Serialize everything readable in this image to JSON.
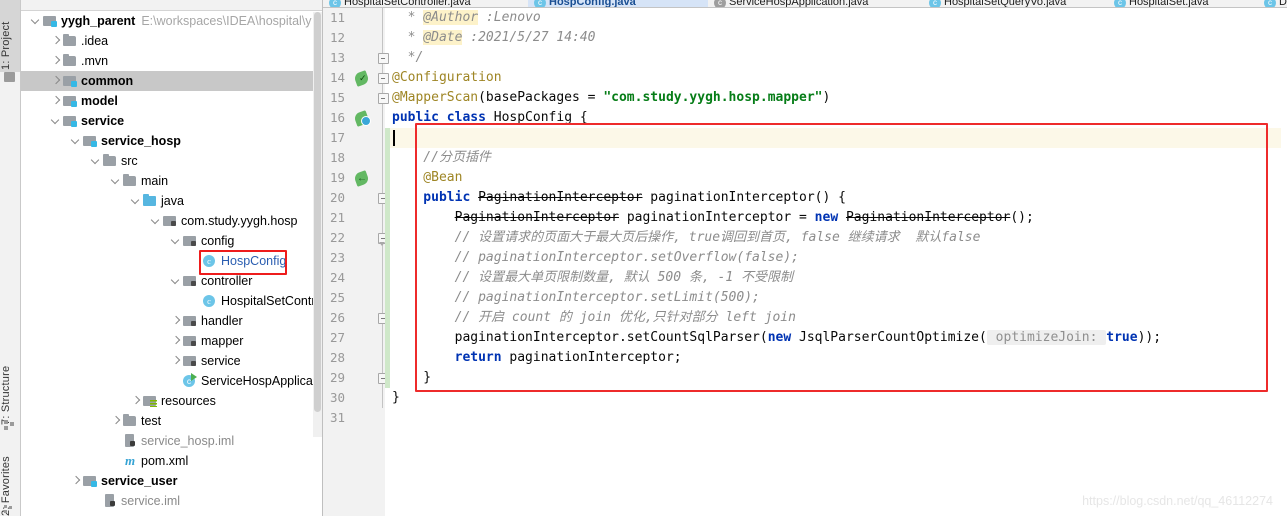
{
  "toolwindows": {
    "project": "1: Project",
    "structure": "7: Structure",
    "favorites": "2: Favorites"
  },
  "project_tree": {
    "root": {
      "label": "yygh_parent",
      "path": "E:\\workspaces\\IDEA\\hospital\\y"
    },
    "items": [
      {
        "label": "yygh_parent",
        "path": "E:\\workspaces\\IDEA\\hospital\\y",
        "icon": "module-folder-icon",
        "indent": 0,
        "arrow": "down",
        "bold": true,
        "selected": false
      },
      {
        "label": ".idea",
        "icon": "folder-icon",
        "indent": 1,
        "arrow": "right",
        "bold": false,
        "selected": false
      },
      {
        "label": ".mvn",
        "icon": "folder-icon",
        "indent": 1,
        "arrow": "right",
        "bold": false,
        "selected": false
      },
      {
        "label": "common",
        "icon": "module-folder-icon",
        "indent": 1,
        "arrow": "right",
        "bold": true,
        "selected": true
      },
      {
        "label": "model",
        "icon": "module-folder-icon",
        "indent": 1,
        "arrow": "right",
        "bold": true,
        "selected": false
      },
      {
        "label": "service",
        "icon": "module-folder-icon",
        "indent": 1,
        "arrow": "down",
        "bold": true,
        "selected": false
      },
      {
        "label": "service_hosp",
        "icon": "module-folder-icon",
        "indent": 2,
        "arrow": "down",
        "bold": true,
        "selected": false
      },
      {
        "label": "src",
        "icon": "folder-icon",
        "indent": 3,
        "arrow": "down",
        "bold": false,
        "selected": false
      },
      {
        "label": "main",
        "icon": "folder-icon",
        "indent": 4,
        "arrow": "down",
        "bold": false,
        "selected": false
      },
      {
        "label": "java",
        "icon": "source-folder-icon",
        "indent": 5,
        "arrow": "down",
        "bold": false,
        "selected": false
      },
      {
        "label": "com.study.yygh.hosp",
        "icon": "package-icon",
        "indent": 6,
        "arrow": "down",
        "bold": false,
        "selected": false
      },
      {
        "label": "config",
        "icon": "package-icon",
        "indent": 7,
        "arrow": "down",
        "bold": false,
        "selected": false
      },
      {
        "label": "HospConfig",
        "icon": "java-class-icon",
        "indent": 8,
        "arrow": "none",
        "bold": false,
        "selected": false,
        "blue": true,
        "highlight": true
      },
      {
        "label": "controller",
        "icon": "package-icon",
        "indent": 7,
        "arrow": "down",
        "bold": false,
        "selected": false
      },
      {
        "label": "HospitalSetContr",
        "icon": "java-class-icon",
        "indent": 8,
        "arrow": "none",
        "bold": false,
        "selected": false
      },
      {
        "label": "handler",
        "icon": "package-icon",
        "indent": 7,
        "arrow": "right",
        "bold": false,
        "selected": false
      },
      {
        "label": "mapper",
        "icon": "package-icon",
        "indent": 7,
        "arrow": "right",
        "bold": false,
        "selected": false
      },
      {
        "label": "service",
        "icon": "package-icon",
        "indent": 7,
        "arrow": "right",
        "bold": false,
        "selected": false
      },
      {
        "label": "ServiceHospApplicat",
        "icon": "spring-boot-class-icon",
        "indent": 7,
        "arrow": "none",
        "bold": false,
        "selected": false
      },
      {
        "label": "resources",
        "icon": "resources-folder-icon",
        "indent": 5,
        "arrow": "right",
        "bold": false,
        "selected": false
      },
      {
        "label": "test",
        "icon": "folder-icon",
        "indent": 4,
        "arrow": "right",
        "bold": false,
        "selected": false
      },
      {
        "label": "service_hosp.iml",
        "icon": "iml-file-icon",
        "indent": 4,
        "arrow": "none",
        "bold": false,
        "selected": false,
        "grey": true
      },
      {
        "label": "pom.xml",
        "icon": "maven-pom-icon",
        "indent": 4,
        "arrow": "none",
        "bold": false,
        "selected": false
      },
      {
        "label": "service_user",
        "icon": "module-folder-icon",
        "indent": 2,
        "arrow": "right",
        "bold": true,
        "selected": false
      },
      {
        "label": "service.iml",
        "icon": "iml-file-icon",
        "indent": 3,
        "arrow": "none",
        "bold": false,
        "selected": false,
        "grey": true
      }
    ]
  },
  "editor_tabs": [
    {
      "label": "HospitalSetController.java",
      "icon": "java-class-icon",
      "active": false
    },
    {
      "label": "HospConfig.java",
      "icon": "java-class-icon",
      "active": true
    },
    {
      "label": "ServiceHospApplication.java",
      "icon": "spring-boot-class-icon",
      "active": false
    },
    {
      "label": "HospitalSetQueryVo.java",
      "icon": "java-class-icon",
      "active": false
    },
    {
      "label": "HospitalSet.java",
      "icon": "java-class-icon",
      "active": false
    },
    {
      "label": "DataSou",
      "icon": "java-class-icon",
      "active": false
    }
  ],
  "editor": {
    "first_line": 11,
    "caret_line": 17,
    "lines": [
      {
        "n": 11,
        "gutter_icon": "none",
        "fold": "none",
        "tokens": [
          {
            "t": "  * ",
            "c": "cmt"
          },
          {
            "t": "@Author",
            "c": "cmt hl"
          },
          {
            "t": " :Lenovo",
            "c": "cmt"
          }
        ]
      },
      {
        "n": 12,
        "gutter_icon": "none",
        "fold": "none",
        "tokens": [
          {
            "t": "  * ",
            "c": "cmt"
          },
          {
            "t": "@Date",
            "c": "cmt hl"
          },
          {
            "t": " :2021/5/27 14:40",
            "c": "cmt"
          }
        ]
      },
      {
        "n": 13,
        "gutter_icon": "none",
        "fold": "end",
        "tokens": [
          {
            "t": "  */",
            "c": "cmt"
          }
        ]
      },
      {
        "n": 14,
        "gutter_icon": "bean-leaf-check-icon",
        "fold": "start",
        "tokens": [
          {
            "t": "@Configuration",
            "c": "ann"
          }
        ]
      },
      {
        "n": 15,
        "gutter_icon": "none",
        "fold": "start",
        "tokens": [
          {
            "t": "@MapperScan",
            "c": "ann"
          },
          {
            "t": "(basePackages = ",
            "c": "plain"
          },
          {
            "t": "\"com.study.yygh.hosp.mapper\"",
            "c": "str"
          },
          {
            "t": ")",
            "c": "plain"
          }
        ]
      },
      {
        "n": 16,
        "gutter_icon": "bean-blue-icon",
        "fold": "none",
        "tokens": [
          {
            "t": "public class ",
            "c": "kw"
          },
          {
            "t": "HospConfig {",
            "c": "plain"
          }
        ]
      },
      {
        "n": 17,
        "gutter_icon": "none",
        "fold": "none",
        "current": true,
        "tokens": []
      },
      {
        "n": 18,
        "gutter_icon": "none",
        "fold": "none",
        "tokens": [
          {
            "t": "    //分页插件",
            "c": "cmt"
          }
        ]
      },
      {
        "n": 19,
        "gutter_icon": "bean-arrow-icon",
        "fold": "none",
        "tokens": [
          {
            "t": "    @Bean",
            "c": "ann"
          }
        ]
      },
      {
        "n": 20,
        "gutter_icon": "none",
        "fold": "start",
        "tokens": [
          {
            "t": "    public ",
            "c": "kw"
          },
          {
            "t": "PaginationInterceptor",
            "c": "plain strike"
          },
          {
            "t": " paginationInterceptor() {",
            "c": "plain"
          }
        ]
      },
      {
        "n": 21,
        "gutter_icon": "none",
        "fold": "none",
        "tokens": [
          {
            "t": "        ",
            "c": "plain"
          },
          {
            "t": "PaginationInterceptor",
            "c": "plain strike"
          },
          {
            "t": " paginationInterceptor = ",
            "c": "plain"
          },
          {
            "t": "new ",
            "c": "kw"
          },
          {
            "t": "PaginationInterceptor",
            "c": "plain strike"
          },
          {
            "t": "();",
            "c": "plain"
          }
        ]
      },
      {
        "n": 22,
        "gutter_icon": "none",
        "fold": "endpoint",
        "tokens": [
          {
            "t": "        // 设置请求的页面大于最大页后操作, true调回到首页, false 继续请求  默认false",
            "c": "cmt"
          }
        ]
      },
      {
        "n": 23,
        "gutter_icon": "none",
        "fold": "none",
        "tokens": [
          {
            "t": "        // paginationInterceptor.setOverflow(false);",
            "c": "cmt"
          }
        ]
      },
      {
        "n": 24,
        "gutter_icon": "none",
        "fold": "none",
        "tokens": [
          {
            "t": "        // 设置最大单页限制数量, 默认 500 条, -1 不受限制",
            "c": "cmt"
          }
        ]
      },
      {
        "n": 25,
        "gutter_icon": "none",
        "fold": "none",
        "tokens": [
          {
            "t": "        // paginationInterceptor.setLimit(500);",
            "c": "cmt"
          }
        ]
      },
      {
        "n": 26,
        "gutter_icon": "none",
        "fold": "end",
        "tokens": [
          {
            "t": "        // 开启 count 的 join 优化,只针对部分 left join",
            "c": "cmt"
          }
        ]
      },
      {
        "n": 27,
        "gutter_icon": "none",
        "fold": "none",
        "tokens": [
          {
            "t": "        paginationInterceptor.setCountSqlParser(",
            "c": "plain"
          },
          {
            "t": "new ",
            "c": "kw"
          },
          {
            "t": "JsqlParserCountOptimize(",
            "c": "plain"
          },
          {
            "t": " optimizeJoin: ",
            "c": "hint"
          },
          {
            "t": "true",
            "c": "kw"
          },
          {
            "t": "));",
            "c": "plain"
          }
        ]
      },
      {
        "n": 28,
        "gutter_icon": "none",
        "fold": "none",
        "tokens": [
          {
            "t": "        return ",
            "c": "kw"
          },
          {
            "t": "paginationInterceptor;",
            "c": "plain"
          }
        ]
      },
      {
        "n": 29,
        "gutter_icon": "none",
        "fold": "end",
        "tokens": [
          {
            "t": "    }",
            "c": "plain"
          }
        ]
      },
      {
        "n": 30,
        "gutter_icon": "none",
        "fold": "none",
        "tokens": [
          {
            "t": "}",
            "c": "plain"
          }
        ]
      },
      {
        "n": 31,
        "gutter_icon": "none",
        "fold": "none",
        "tokens": []
      }
    ]
  },
  "annotations": {
    "code_highlight_box_color": "#ee2b2b",
    "tree_highlight_box_color": "#ee1c1c"
  },
  "watermark": "https://blog.csdn.net/qq_46112274"
}
